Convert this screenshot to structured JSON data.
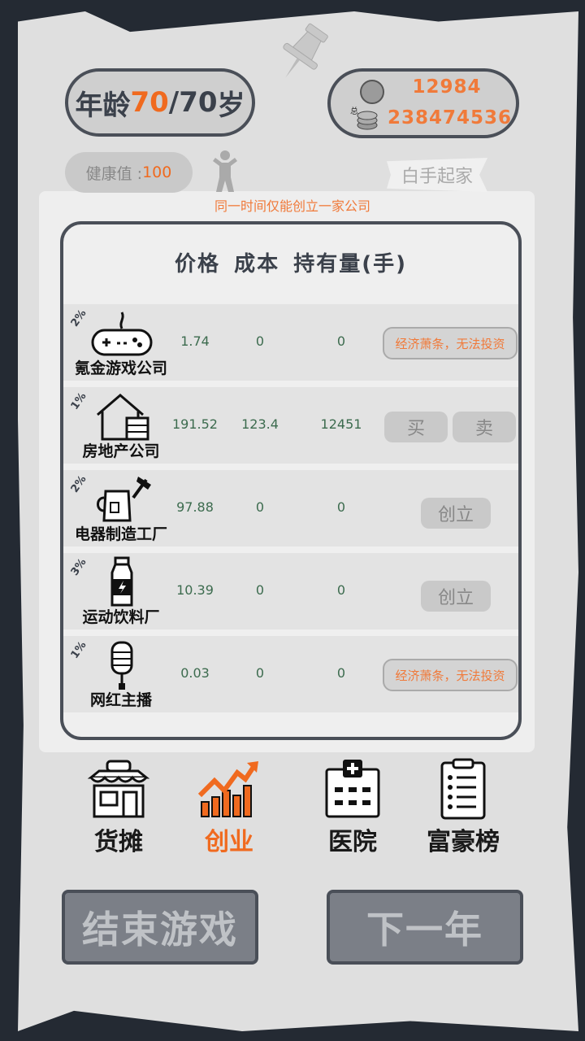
{
  "header": {
    "age_label": "年龄",
    "age_current": "70",
    "age_sep": "/",
    "age_max": "70",
    "age_unit": "岁",
    "cash": "12984",
    "total_label": "总",
    "total": "238474536",
    "health_label": "健康值 :",
    "health_value": "100",
    "badge": "白手起家",
    "notice": "同一时间仅能创立一家公司"
  },
  "table": {
    "headers": [
      "价格",
      "成本",
      "持有量(手)"
    ],
    "rows": [
      {
        "pct": "2%",
        "name": "氪金游戏公司",
        "icon": "gamepad-icon",
        "price": "1.74",
        "cost": "0",
        "holding": "0",
        "action": "经济萧条，无法投资",
        "type": "warn"
      },
      {
        "pct": "1%",
        "name": "房地产公司",
        "icon": "house-icon",
        "price": "191.52",
        "cost": "123.4",
        "holding": "12451",
        "buy": "买",
        "sell": "卖",
        "type": "trade"
      },
      {
        "pct": "2%",
        "name": "电器制造工厂",
        "icon": "kettle-hammer-icon",
        "price": "97.88",
        "cost": "0",
        "holding": "0",
        "action": "创立",
        "type": "create"
      },
      {
        "pct": "3%",
        "name": "运动饮料厂",
        "icon": "bottle-icon",
        "price": "10.39",
        "cost": "0",
        "holding": "0",
        "action": "创立",
        "type": "create"
      },
      {
        "pct": "1%",
        "name": "网红主播",
        "icon": "microphone-icon",
        "price": "0.03",
        "cost": "0",
        "holding": "0",
        "action": "经济萧条，无法投资",
        "type": "warn"
      }
    ]
  },
  "nav": {
    "stall": "货摊",
    "startup": "创业",
    "hospital": "医院",
    "rich_list": "富豪榜"
  },
  "buttons": {
    "end_game": "结束游戏",
    "next_year": "下一年"
  },
  "colors": {
    "accent": "#f06a1f",
    "text_green": "#3c6b4e",
    "frame": "#4a4f58"
  }
}
